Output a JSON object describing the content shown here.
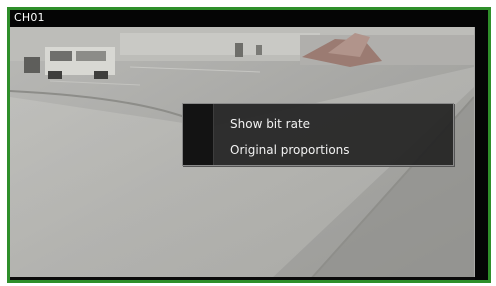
{
  "window": {
    "channel_label": "CH01",
    "border_color": "#2f8f2a"
  },
  "context_menu": {
    "items": [
      {
        "label": "Show bit rate"
      },
      {
        "label": "Original proportions"
      }
    ]
  }
}
